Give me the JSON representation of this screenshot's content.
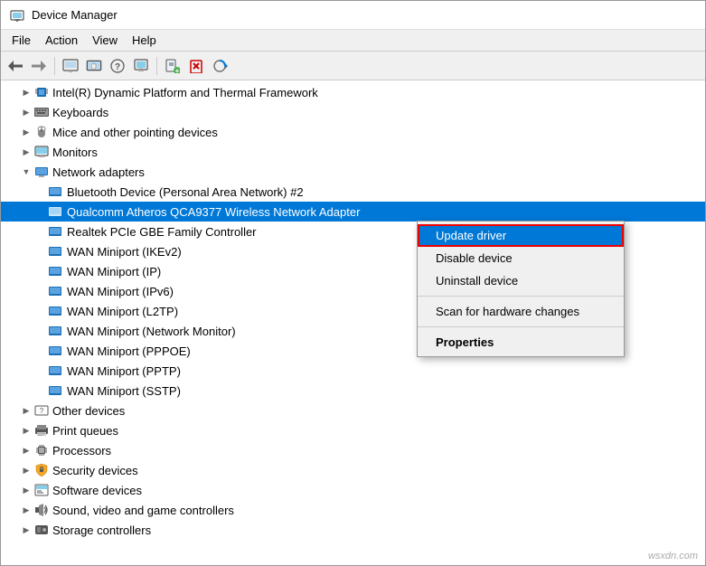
{
  "window": {
    "title": "Device Manager"
  },
  "menubar": {
    "items": [
      "File",
      "Action",
      "View",
      "Help"
    ]
  },
  "toolbar": {
    "buttons": [
      "←",
      "→",
      "🖥",
      "📋",
      "❓",
      "🖼",
      "🖨",
      "✖",
      "⊕"
    ]
  },
  "tree": {
    "items": [
      {
        "id": "intel",
        "level": 1,
        "label": "Intel(R) Dynamic Platform and Thermal Framework",
        "icon": "chip",
        "expanded": false
      },
      {
        "id": "keyboards",
        "level": 1,
        "label": "Keyboards",
        "icon": "keyboard",
        "expanded": false
      },
      {
        "id": "mice",
        "level": 1,
        "label": "Mice and other pointing devices",
        "icon": "mouse",
        "expanded": false
      },
      {
        "id": "monitors",
        "level": 1,
        "label": "Monitors",
        "icon": "monitor",
        "expanded": false
      },
      {
        "id": "network",
        "level": 1,
        "label": "Network adapters",
        "icon": "network",
        "expanded": true
      },
      {
        "id": "bluetooth",
        "level": 2,
        "label": "Bluetooth Device (Personal Area Network) #2",
        "icon": "network-adapter",
        "expanded": false
      },
      {
        "id": "qualcomm",
        "level": 2,
        "label": "Qualcomm Atheros QCA9377 Wireless Network Adapter",
        "icon": "network-adapter",
        "expanded": false,
        "selected": true
      },
      {
        "id": "realtek",
        "level": 2,
        "label": "Realtek PCIe GBE Family Controller",
        "icon": "network-adapter",
        "expanded": false
      },
      {
        "id": "wan1",
        "level": 2,
        "label": "WAN Miniport (IKEv2)",
        "icon": "network-adapter",
        "expanded": false
      },
      {
        "id": "wan2",
        "level": 2,
        "label": "WAN Miniport (IP)",
        "icon": "network-adapter",
        "expanded": false
      },
      {
        "id": "wan3",
        "level": 2,
        "label": "WAN Miniport (IPv6)",
        "icon": "network-adapter",
        "expanded": false
      },
      {
        "id": "wan4",
        "level": 2,
        "label": "WAN Miniport (L2TP)",
        "icon": "network-adapter",
        "expanded": false
      },
      {
        "id": "wan5",
        "level": 2,
        "label": "WAN Miniport (Network Monitor)",
        "icon": "network-adapter",
        "expanded": false
      },
      {
        "id": "wan6",
        "level": 2,
        "label": "WAN Miniport (PPPOE)",
        "icon": "network-adapter",
        "expanded": false
      },
      {
        "id": "wan7",
        "level": 2,
        "label": "WAN Miniport (PPTP)",
        "icon": "network-adapter",
        "expanded": false
      },
      {
        "id": "wan8",
        "level": 2,
        "label": "WAN Miniport (SSTP)",
        "icon": "network-adapter",
        "expanded": false
      },
      {
        "id": "other",
        "level": 1,
        "label": "Other devices",
        "icon": "other",
        "expanded": false
      },
      {
        "id": "print",
        "level": 1,
        "label": "Print queues",
        "icon": "printer",
        "expanded": false
      },
      {
        "id": "processors",
        "level": 1,
        "label": "Processors",
        "icon": "cpu",
        "expanded": false
      },
      {
        "id": "security",
        "level": 1,
        "label": "Security devices",
        "icon": "security",
        "expanded": false
      },
      {
        "id": "software",
        "level": 1,
        "label": "Software devices",
        "icon": "software",
        "expanded": false
      },
      {
        "id": "sound",
        "level": 1,
        "label": "Sound, video and game controllers",
        "icon": "sound",
        "expanded": false
      },
      {
        "id": "storage",
        "level": 1,
        "label": "Storage controllers",
        "icon": "storage",
        "expanded": false
      }
    ]
  },
  "context_menu": {
    "items": [
      {
        "id": "update",
        "label": "Update driver",
        "highlighted": true,
        "bold": false,
        "separator_after": false
      },
      {
        "id": "disable",
        "label": "Disable device",
        "highlighted": false,
        "bold": false,
        "separator_after": false
      },
      {
        "id": "uninstall",
        "label": "Uninstall device",
        "highlighted": false,
        "bold": false,
        "separator_after": true
      },
      {
        "id": "scan",
        "label": "Scan for hardware changes",
        "highlighted": false,
        "bold": false,
        "separator_after": true
      },
      {
        "id": "properties",
        "label": "Properties",
        "highlighted": false,
        "bold": true,
        "separator_after": false
      }
    ]
  },
  "watermark": "wsxdn.com"
}
